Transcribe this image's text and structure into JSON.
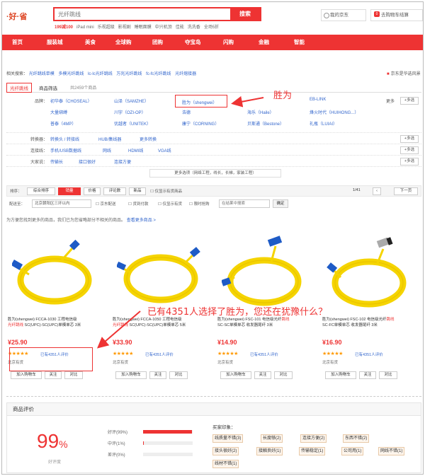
{
  "header": {
    "logo": "·好·省",
    "search_placeholder": "光纤跳线",
    "search_button": "搜索",
    "hot_words": [
      "199减100",
      "iPad mini",
      "乐视超级",
      "影视剧",
      "睡眠面膜",
      "中兴机顶",
      "佳能",
      "洗洗香",
      "全场5折"
    ],
    "my_jd": "我的京东",
    "cart": "去购物车结算",
    "cart_count": "0"
  },
  "nav": [
    "首页",
    "服装城",
    "美食",
    "全球购",
    "团购",
    "夺宝岛",
    "闪购",
    "金融",
    "智能"
  ],
  "related": {
    "label": "相关搜索：",
    "links": [
      "光纤跳线单模",
      "多模光纤跳线",
      "lc-lc光纤跳线",
      "万兆光纤跳线",
      "fc-fc光纤跳线",
      "光纤熔接器"
    ],
    "ad": "京东是华选风景"
  },
  "breadcrumb": {
    "tag": "光纤跳线",
    "section": "商品筛选",
    "count": "共2459个商品"
  },
  "filters": {
    "brand_label": "品牌：",
    "brands_row1": [
      "初华泰（CHOSEAL）",
      "山泽（SAMZHE）",
      "胜为（shengwei）",
      "EB-LINK"
    ],
    "brands_row2": [
      "大量绑缚",
      "川宇（OZI-OP）",
      "浩德",
      "海乐（Haile）",
      "烽火时代（HUIHONG...）"
    ],
    "brands_row3": [
      "普泰（4MP）",
      "优越者（UNITEK）",
      "康宁（CORNING）",
      "贝斯通（Bestone）",
      "礼瓶（LUIAI）"
    ],
    "more": "更多",
    "multi": "+多选",
    "converter_label": "转换器：",
    "converter_values": [
      "转换头 / 转接线",
      "HUB/集线器",
      "更多转换"
    ],
    "connector_label": "连接线：",
    "connector_values": [
      "手机/USB数据线",
      "网线",
      "HDMI线",
      "VGA线"
    ],
    "common_label": "大家说：",
    "common_values": [
      "传输长",
      "接口很好",
      "连接方便"
    ],
    "more_options": "更多选项（网络工程，线长，长梯，家装工程）"
  },
  "sortbar": {
    "label": "排序：",
    "options": [
      "综合排序",
      "销量",
      "价格",
      "评论数",
      "新品"
    ],
    "active": "销量",
    "only_stock": "仅显示有货商品",
    "page": "1/41",
    "next": "下一页"
  },
  "delivery": {
    "label": "配送至：",
    "location": "北京朝阳区三环以内",
    "checks": [
      "京东配送",
      "货到付款",
      "仅显示有货",
      "限时抢购"
    ],
    "in_search_placeholder": "在结果中搜索",
    "confirm": "确定"
  },
  "notice": {
    "text": "为方便您找到更多的商品，我们已为您省略部分不相关的商品。",
    "link": "查看更多商品 >"
  },
  "products": [
    {
      "title_a": "胜为(shengwei) FCCA-1030 工程电信级",
      "title_red": "光纤跳线",
      "title_b": "SC(UPC)-SC(UPC)单模单芯 3米",
      "price": "¥25.90",
      "reviews": "已有4351人评价",
      "shop": "北京有货",
      "buttons": [
        "加入购物车",
        "关注",
        "对比"
      ]
    },
    {
      "title_a": "胜为(shengwei) FCCA-1050 工程电信级",
      "title_red": "光纤跳线",
      "title_b": "SC(UPC)-SC(UPC)单模单芯 5米",
      "price": "¥33.90",
      "reviews": "已有4351人评价",
      "shop": "北京有货",
      "buttons": [
        "加入购物车",
        "关注",
        "对比"
      ]
    },
    {
      "title_a": "胜为(shengwei) FSC-101 电信级光纤",
      "title_red": "跳线",
      "title_b": "SC-SC单模单芯 收发器尾纤 3米",
      "price": "¥14.90",
      "reviews": "已有4351人评价",
      "shop": "北京有货",
      "buttons": [
        "加入购物车",
        "关注",
        "对比"
      ]
    },
    {
      "title_a": "胜为(shengwei) FSC-102 电信级光纤",
      "title_red": "跳线",
      "title_b": "SC-FC单模单芯 收发器尾纤 3米",
      "price": "¥16.90",
      "reviews": "已有4351人评价",
      "shop": "北京有货",
      "buttons": [
        "加入购物车",
        "关注",
        "对比"
      ]
    }
  ],
  "annotations": {
    "brand_arrow": "胜为",
    "question": "已有4351人选择了胜为，您还在犹豫什么？"
  },
  "rating": {
    "header": "商品评价",
    "percent": "99",
    "percent_unit": "%",
    "percent_label": "好评度",
    "rows": [
      {
        "label": "好评(99%)",
        "value": 0.99
      },
      {
        "label": "中评(1%)",
        "value": 0.01
      },
      {
        "label": "差评(0%)",
        "value": 0.0
      }
    ],
    "impression_label": "买家印象：",
    "tags": [
      "线质量不错(3)",
      "长度够(2)",
      "连接方便(2)",
      "东西不错(2)",
      "接头很好(2)",
      "接触良好(1)",
      "传输稳定(1)",
      "公司用(1)",
      "网线不错(1)",
      "线材不错(1)"
    ]
  },
  "colors": {
    "accent": "#e33",
    "link": "#36c",
    "star": "#f90"
  }
}
